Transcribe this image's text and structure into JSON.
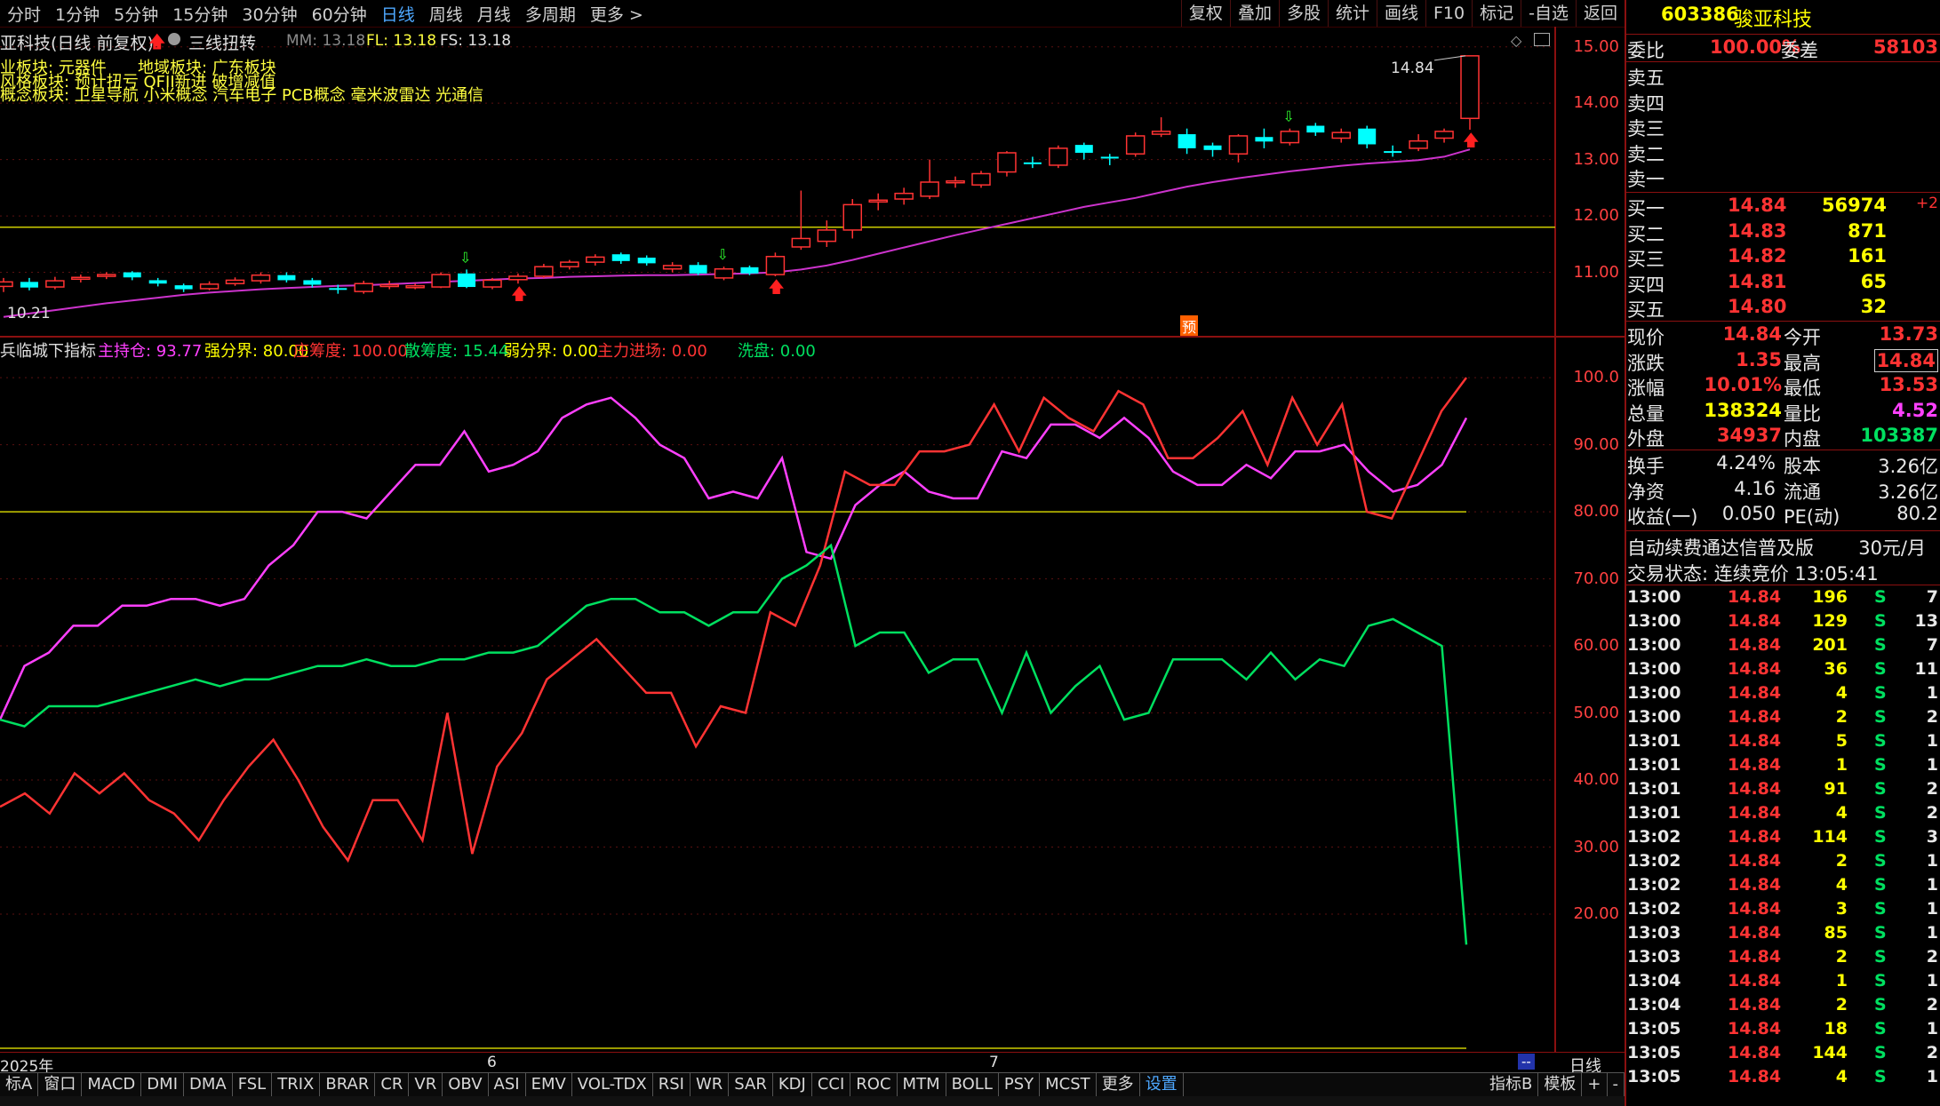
{
  "toolbar": {
    "periods": [
      "分时",
      "1分钟",
      "5分钟",
      "15分钟",
      "30分钟",
      "60分钟",
      "日线",
      "周线",
      "月线",
      "多周期",
      "更多 >"
    ],
    "active_period": "日线",
    "tools": [
      "复权",
      "叠加",
      "多股",
      "统计",
      "画线",
      "F10",
      "标记",
      "-自选",
      "返回"
    ]
  },
  "chart_header": {
    "title": "亚科技(日线 前复权)",
    "pattern": "三线扭转",
    "mm": "MM: 13.18",
    "fl": "FL: 13.18",
    "fs": "FS: 13.18"
  },
  "sectors": {
    "line1": "业板块: 元器件",
    "line1b": "地域板块: 广东板块",
    "line2": "风格板块: 预计扭亏 QFII新进 破增减值",
    "line3": "概念板块: 卫星导航 小米概念 汽车电子 PCB概念 毫米波雷达 光通信"
  },
  "main_chart": {
    "high_label": "14.84",
    "low_label": "10.21",
    "yaxis": [
      "15.00",
      "14.00",
      "13.00",
      "12.00",
      "11.00"
    ],
    "pre_badge": "预"
  },
  "indicator": {
    "name": "兵临城下指标",
    "values": [
      {
        "label": "主持仓: 93.77",
        "color": "#ff40ff"
      },
      {
        "label": "强分界: 80.00",
        "color": "#ffff00"
      },
      {
        "label": "庄筹度: 100.00",
        "color": "#ff3333"
      },
      {
        "label": "散筹度: 15.44",
        "color": "#00e060"
      },
      {
        "label": "弱分界: 0.00",
        "color": "#ffff00"
      },
      {
        "label": "主力进场: 0.00",
        "color": "#ff3333"
      },
      {
        "label": "洗盘: 0.00",
        "color": "#00e060"
      }
    ],
    "yaxis": [
      "100.0",
      "90.00",
      "80.00",
      "70.00",
      "60.00",
      "50.00",
      "40.00",
      "30.00",
      "20.00"
    ]
  },
  "chart_data": {
    "type": "line",
    "candles_title": "日线 K线 (前复权)",
    "candles": [
      {
        "o": 10.75,
        "c": 10.83,
        "h": 10.9,
        "l": 10.65
      },
      {
        "o": 10.83,
        "c": 10.73,
        "h": 10.9,
        "l": 10.68
      },
      {
        "o": 10.74,
        "c": 10.85,
        "h": 10.92,
        "l": 10.7
      },
      {
        "o": 10.88,
        "c": 10.91,
        "h": 10.96,
        "l": 10.82
      },
      {
        "o": 10.93,
        "c": 10.96,
        "h": 11.0,
        "l": 10.88
      },
      {
        "o": 11.0,
        "c": 10.91,
        "h": 11.02,
        "l": 10.86
      },
      {
        "o": 10.86,
        "c": 10.8,
        "h": 10.9,
        "l": 10.75
      },
      {
        "o": 10.77,
        "c": 10.7,
        "h": 10.8,
        "l": 10.65
      },
      {
        "o": 10.71,
        "c": 10.79,
        "h": 10.84,
        "l": 10.68
      },
      {
        "o": 10.8,
        "c": 10.86,
        "h": 10.91,
        "l": 10.76
      },
      {
        "o": 10.85,
        "c": 10.95,
        "h": 11.0,
        "l": 10.8
      },
      {
        "o": 10.95,
        "c": 10.86,
        "h": 11.0,
        "l": 10.82
      },
      {
        "o": 10.86,
        "c": 10.78,
        "h": 10.9,
        "l": 10.73
      },
      {
        "o": 10.72,
        "c": 10.7,
        "h": 10.78,
        "l": 10.62
      },
      {
        "o": 10.66,
        "c": 10.8,
        "h": 10.85,
        "l": 10.62
      },
      {
        "o": 10.76,
        "c": 10.78,
        "h": 10.85,
        "l": 10.7
      },
      {
        "o": 10.75,
        "c": 10.76,
        "h": 10.8,
        "l": 10.7
      },
      {
        "o": 10.74,
        "c": 10.96,
        "h": 11.0,
        "l": 10.72
      },
      {
        "o": 10.98,
        "c": 10.74,
        "h": 11.05,
        "l": 10.72
      },
      {
        "o": 10.74,
        "c": 10.86,
        "h": 10.9,
        "l": 10.7
      },
      {
        "o": 10.87,
        "c": 10.93,
        "h": 10.98,
        "l": 10.8
      },
      {
        "o": 10.93,
        "c": 11.1,
        "h": 11.15,
        "l": 10.9
      },
      {
        "o": 11.1,
        "c": 11.18,
        "h": 11.22,
        "l": 11.05
      },
      {
        "o": 11.18,
        "c": 11.27,
        "h": 11.32,
        "l": 11.12
      },
      {
        "o": 11.32,
        "c": 11.2,
        "h": 11.35,
        "l": 11.15
      },
      {
        "o": 11.26,
        "c": 11.16,
        "h": 11.3,
        "l": 11.12
      },
      {
        "o": 11.06,
        "c": 11.12,
        "h": 11.18,
        "l": 11.0
      },
      {
        "o": 11.13,
        "c": 10.98,
        "h": 11.18,
        "l": 10.95
      },
      {
        "o": 10.9,
        "c": 11.06,
        "h": 11.1,
        "l": 10.86
      },
      {
        "o": 11.09,
        "c": 10.98,
        "h": 11.12,
        "l": 10.95
      },
      {
        "o": 10.96,
        "c": 11.28,
        "h": 11.35,
        "l": 10.93
      },
      {
        "o": 11.45,
        "c": 11.6,
        "h": 12.45,
        "l": 11.4
      },
      {
        "o": 11.55,
        "c": 11.75,
        "h": 11.92,
        "l": 11.45
      },
      {
        "o": 11.75,
        "c": 12.2,
        "h": 12.3,
        "l": 11.6
      },
      {
        "o": 12.25,
        "c": 12.28,
        "h": 12.4,
        "l": 12.1
      },
      {
        "o": 12.3,
        "c": 12.4,
        "h": 12.5,
        "l": 12.2
      },
      {
        "o": 12.35,
        "c": 12.6,
        "h": 13.0,
        "l": 12.3
      },
      {
        "o": 12.6,
        "c": 12.62,
        "h": 12.7,
        "l": 12.5
      },
      {
        "o": 12.55,
        "c": 12.75,
        "h": 12.8,
        "l": 12.5
      },
      {
        "o": 12.78,
        "c": 13.12,
        "h": 13.15,
        "l": 12.7
      },
      {
        "o": 12.95,
        "c": 12.92,
        "h": 13.05,
        "l": 12.85
      },
      {
        "o": 12.9,
        "c": 13.2,
        "h": 13.25,
        "l": 12.85
      },
      {
        "o": 13.26,
        "c": 13.12,
        "h": 13.3,
        "l": 13.0
      },
      {
        "o": 13.05,
        "c": 13.02,
        "h": 13.1,
        "l": 12.9
      },
      {
        "o": 13.1,
        "c": 13.42,
        "h": 13.48,
        "l": 13.05
      },
      {
        "o": 13.45,
        "c": 13.5,
        "h": 13.75,
        "l": 13.4
      },
      {
        "o": 13.45,
        "c": 13.2,
        "h": 13.55,
        "l": 13.1
      },
      {
        "o": 13.25,
        "c": 13.17,
        "h": 13.3,
        "l": 13.05
      },
      {
        "o": 13.1,
        "c": 13.42,
        "h": 13.45,
        "l": 12.95
      },
      {
        "o": 13.4,
        "c": 13.32,
        "h": 13.55,
        "l": 13.2
      },
      {
        "o": 13.3,
        "c": 13.5,
        "h": 13.55,
        "l": 13.25
      },
      {
        "o": 13.6,
        "c": 13.48,
        "h": 13.65,
        "l": 13.42
      },
      {
        "o": 13.38,
        "c": 13.48,
        "h": 13.55,
        "l": 13.3
      },
      {
        "o": 13.55,
        "c": 13.27,
        "h": 13.6,
        "l": 13.2
      },
      {
        "o": 13.15,
        "c": 13.12,
        "h": 13.25,
        "l": 13.05
      },
      {
        "o": 13.2,
        "c": 13.33,
        "h": 13.45,
        "l": 13.15
      },
      {
        "o": 13.38,
        "c": 13.5,
        "h": 13.55,
        "l": 13.3
      },
      {
        "o": 13.73,
        "c": 14.84,
        "h": 14.84,
        "l": 13.53
      }
    ],
    "ma": [
      10.21,
      10.27,
      10.33,
      10.39,
      10.45,
      10.5,
      10.55,
      10.6,
      10.64,
      10.67,
      10.7,
      10.72,
      10.74,
      10.76,
      10.77,
      10.79,
      10.81,
      10.83,
      10.85,
      10.87,
      10.89,
      10.9,
      10.92,
      10.93,
      10.94,
      10.95,
      10.95,
      10.96,
      10.97,
      10.98,
      11.0,
      11.05,
      11.12,
      11.22,
      11.33,
      11.44,
      11.55,
      11.66,
      11.76,
      11.86,
      11.96,
      12.06,
      12.16,
      12.24,
      12.32,
      12.42,
      12.52,
      12.6,
      12.67,
      12.73,
      12.79,
      12.84,
      12.89,
      12.93,
      12.96,
      12.99,
      13.05,
      13.18
    ],
    "ref_line": 11.8,
    "ylim": [
      10.0,
      15.2
    ],
    "up_arrows": [
      20,
      30,
      57
    ],
    "down_arrows": [
      18,
      28,
      50
    ],
    "series": [
      {
        "name": "主持仓",
        "color": "#ff40ff",
        "values": [
          49,
          57,
          59,
          63,
          63,
          66,
          66,
          67,
          67,
          66,
          67,
          72,
          75,
          80,
          80,
          79,
          83,
          87,
          87,
          92,
          86,
          87,
          89,
          94,
          96,
          97,
          94,
          90,
          88,
          82,
          83,
          82,
          88,
          74,
          73,
          81,
          84,
          86,
          83,
          82,
          82,
          89,
          88,
          93,
          93,
          91,
          94,
          91,
          86,
          84,
          84,
          87,
          85,
          89,
          89,
          90,
          86,
          83,
          84,
          87,
          94
        ]
      },
      {
        "name": "庄筹度",
        "color": "#ff3333",
        "values": [
          36,
          38,
          35,
          41,
          38,
          41,
          37,
          35,
          31,
          37,
          42,
          46,
          40,
          33,
          28,
          37,
          37,
          31,
          50,
          29,
          42,
          47,
          55,
          58,
          61,
          57,
          53,
          53,
          45,
          51,
          50,
          65,
          63,
          72,
          86,
          84,
          84,
          89,
          89,
          90,
          96,
          89,
          97,
          94,
          92,
          98,
          96,
          88,
          88,
          91,
          95,
          87,
          97,
          90,
          96,
          80,
          79,
          87,
          95,
          100
        ]
      },
      {
        "name": "散筹度",
        "color": "#00e060",
        "values": [
          49,
          48,
          51,
          51,
          51,
          52,
          53,
          54,
          55,
          54,
          55,
          55,
          56,
          57,
          57,
          58,
          57,
          57,
          58,
          58,
          59,
          59,
          60,
          63,
          66,
          67,
          67,
          65,
          65,
          63,
          65,
          65,
          70,
          72,
          75,
          60,
          62,
          62,
          56,
          58,
          58,
          50,
          59,
          50,
          54,
          57,
          49,
          50,
          58,
          58,
          58,
          55,
          59,
          55,
          58,
          57,
          63,
          64,
          62,
          60,
          15.44
        ]
      }
    ],
    "thresholds": {
      "strong": 80,
      "weak": 0
    },
    "indicator_ylim": [
      0,
      102
    ]
  },
  "timeline": {
    "labels": [
      "2025年",
      "6",
      "7"
    ],
    "period_label": "日线",
    "blue_box": "--"
  },
  "bottom_tabs": [
    "标A",
    "窗口",
    "MACD",
    "DMI",
    "DMA",
    "FSL",
    "TRIX",
    "BRAR",
    "CR",
    "VR",
    "OBV",
    "ASI",
    "EMV",
    "VOL-TDX",
    "RSI",
    "WR",
    "SAR",
    "KDJ",
    "CCI",
    "ROC",
    "MTM",
    "BOLL",
    "PSY",
    "MCST",
    "更多",
    "设置"
  ],
  "bottom_right_tabs": [
    "指标B",
    "模板",
    "+",
    "-"
  ],
  "quote": {
    "code": "603386",
    "name": "骏亚科技",
    "weibi_label": "委比",
    "weibi": "100.00%",
    "weicha_label": "委差",
    "weicha": "58103",
    "asks": [
      "卖五",
      "卖四",
      "卖三",
      "卖二",
      "卖一"
    ],
    "bids": [
      {
        "label": "买一",
        "price": "14.84",
        "vol": "56974",
        "chg": "+2"
      },
      {
        "label": "买二",
        "price": "14.83",
        "vol": "871",
        "chg": ""
      },
      {
        "label": "买三",
        "price": "14.82",
        "vol": "161",
        "chg": ""
      },
      {
        "label": "买四",
        "price": "14.81",
        "vol": "65",
        "chg": ""
      },
      {
        "label": "买五",
        "price": "14.80",
        "vol": "32",
        "chg": ""
      }
    ],
    "stats": [
      {
        "l1": "现价",
        "v1": "14.84",
        "c1": "red",
        "l2": "今开",
        "v2": "13.73",
        "c2": "red"
      },
      {
        "l1": "涨跌",
        "v1": "1.35",
        "c1": "red",
        "l2": "最高",
        "v2": "14.84",
        "c2": "red"
      },
      {
        "l1": "涨幅",
        "v1": "10.01%",
        "c1": "red",
        "l2": "最低",
        "v2": "13.53",
        "c2": "red"
      },
      {
        "l1": "总量",
        "v1": "138324",
        "c1": "yel",
        "l2": "量比",
        "v2": "4.52",
        "c2": "mag"
      },
      {
        "l1": "外盘",
        "v1": "34937",
        "c1": "red",
        "l2": "内盘",
        "v2": "103387",
        "c2": "grn"
      }
    ],
    "fundamentals": [
      {
        "l1": "换手",
        "v1": "4.24%",
        "l2": "股本",
        "v2": "3.26亿"
      },
      {
        "l1": "净资",
        "v1": "4.16",
        "l2": "流通",
        "v2": "3.26亿"
      },
      {
        "l1": "收益(一)",
        "v1": "0.050",
        "l2": "PE(动)",
        "v2": "80.2"
      }
    ],
    "promo": "自动续费通达信普及版",
    "promo_price": "30元/月",
    "status": "交易状态: 连续竞价 13:05:41",
    "ticks": [
      {
        "t": "13:00",
        "p": "14.84",
        "v": "196",
        "s": "S",
        "n": "7"
      },
      {
        "t": "13:00",
        "p": "14.84",
        "v": "129",
        "s": "S",
        "n": "13"
      },
      {
        "t": "13:00",
        "p": "14.84",
        "v": "201",
        "s": "S",
        "n": "7"
      },
      {
        "t": "13:00",
        "p": "14.84",
        "v": "36",
        "s": "S",
        "n": "11"
      },
      {
        "t": "13:00",
        "p": "14.84",
        "v": "4",
        "s": "S",
        "n": "1"
      },
      {
        "t": "13:00",
        "p": "14.84",
        "v": "2",
        "s": "S",
        "n": "2"
      },
      {
        "t": "13:01",
        "p": "14.84",
        "v": "5",
        "s": "S",
        "n": "1"
      },
      {
        "t": "13:01",
        "p": "14.84",
        "v": "1",
        "s": "S",
        "n": "1"
      },
      {
        "t": "13:01",
        "p": "14.84",
        "v": "91",
        "s": "S",
        "n": "2"
      },
      {
        "t": "13:01",
        "p": "14.84",
        "v": "4",
        "s": "S",
        "n": "2"
      },
      {
        "t": "13:02",
        "p": "14.84",
        "v": "114",
        "s": "S",
        "n": "3"
      },
      {
        "t": "13:02",
        "p": "14.84",
        "v": "2",
        "s": "S",
        "n": "1"
      },
      {
        "t": "13:02",
        "p": "14.84",
        "v": "4",
        "s": "S",
        "n": "1"
      },
      {
        "t": "13:02",
        "p": "14.84",
        "v": "3",
        "s": "S",
        "n": "1"
      },
      {
        "t": "13:03",
        "p": "14.84",
        "v": "85",
        "s": "S",
        "n": "1"
      },
      {
        "t": "13:03",
        "p": "14.84",
        "v": "2",
        "s": "S",
        "n": "2"
      },
      {
        "t": "13:04",
        "p": "14.84",
        "v": "1",
        "s": "S",
        "n": "1"
      },
      {
        "t": "13:04",
        "p": "14.84",
        "v": "2",
        "s": "S",
        "n": "2"
      },
      {
        "t": "13:05",
        "p": "14.84",
        "v": "18",
        "s": "S",
        "n": "1"
      },
      {
        "t": "13:05",
        "p": "14.84",
        "v": "144",
        "s": "S",
        "n": "2"
      },
      {
        "t": "13:05",
        "p": "14.84",
        "v": "4",
        "s": "S",
        "n": "1"
      }
    ]
  },
  "colors": {
    "up": "#ff3333",
    "down": "#00ffff",
    "ma": "#cc33cc",
    "ref": "#cccc00",
    "frame": "#8b1010",
    "accent": "#4ea8ff"
  }
}
